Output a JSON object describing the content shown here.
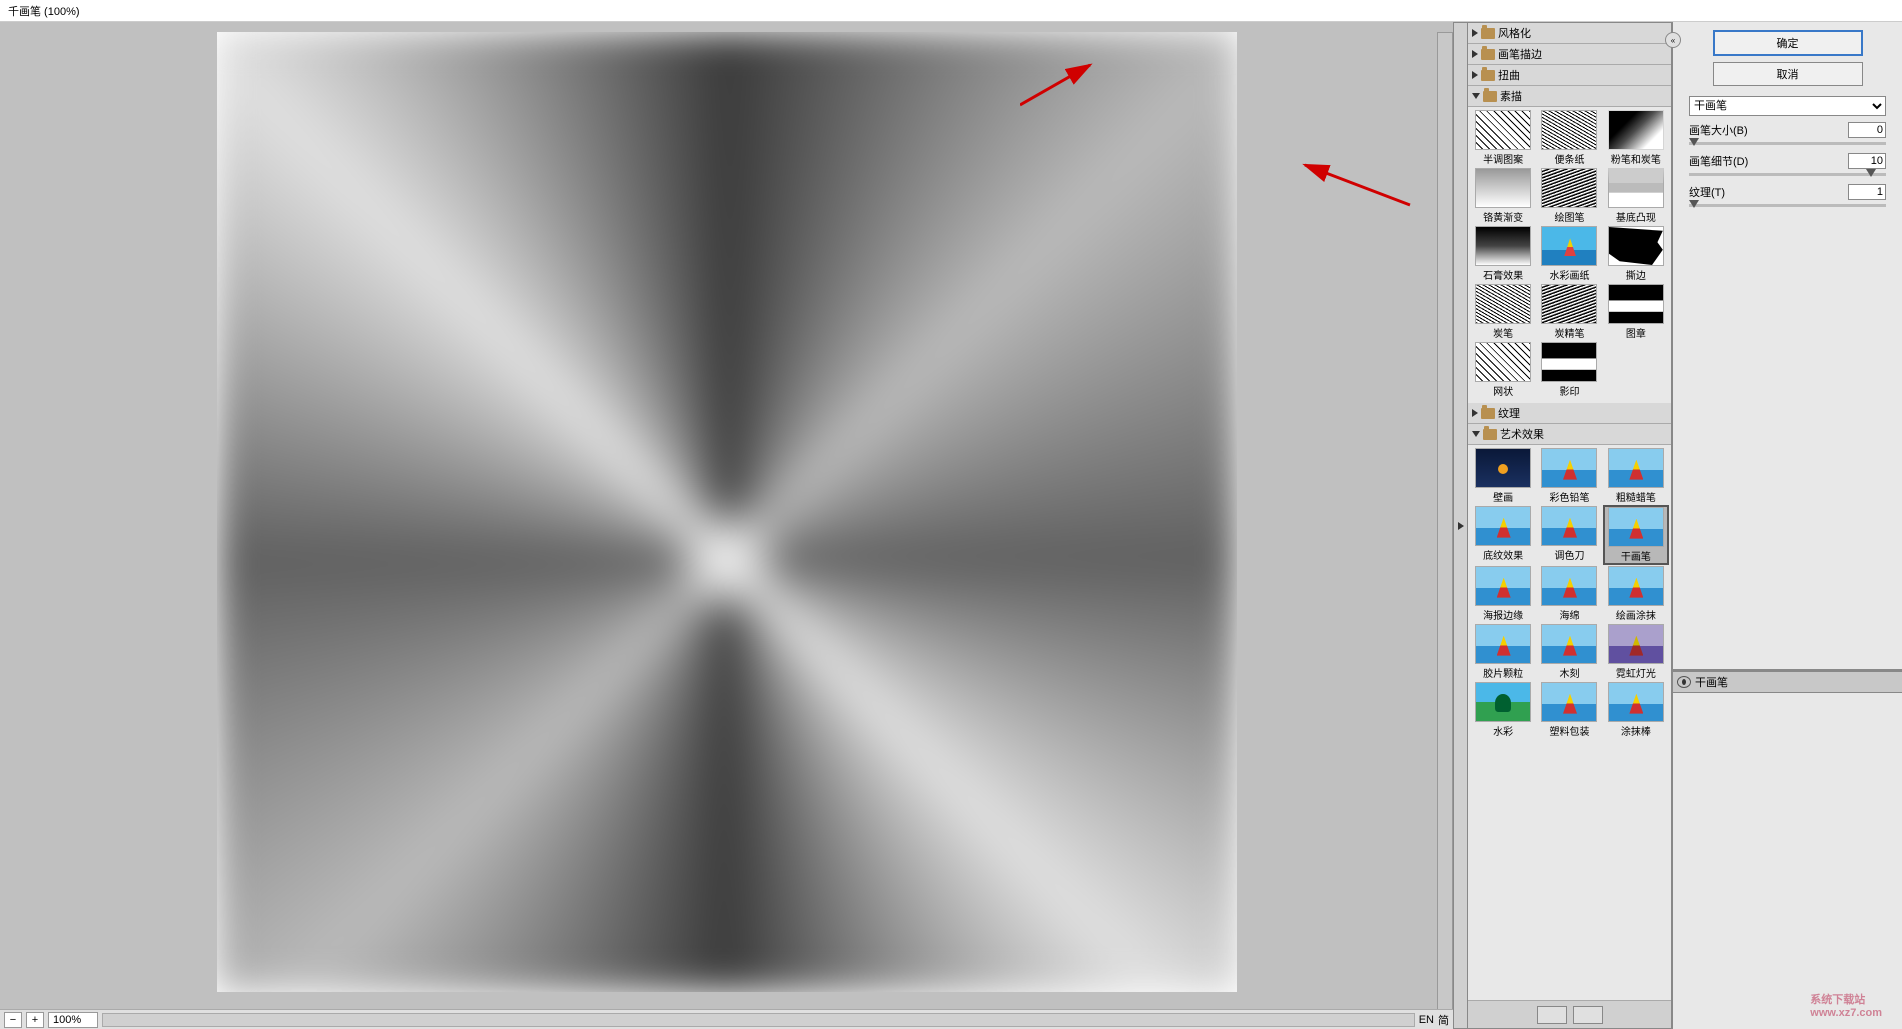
{
  "title": "千画笔 (100%)",
  "zoom": {
    "minus": "−",
    "plus": "+",
    "value": "100%"
  },
  "status": {
    "ime": "EN",
    "lang": "简"
  },
  "categories": {
    "stylize": "风格化",
    "brush_strokes": "画笔描边",
    "distort": "扭曲",
    "sketch": "素描",
    "texture": "纹理",
    "artistic": "艺术效果"
  },
  "sketch_thumbs": [
    {
      "label": "半调图案"
    },
    {
      "label": "便条纸"
    },
    {
      "label": "粉笔和炭笔"
    },
    {
      "label": "铬黄渐变"
    },
    {
      "label": "绘图笔"
    },
    {
      "label": "基底凸现"
    },
    {
      "label": "石膏效果"
    },
    {
      "label": "水彩画纸"
    },
    {
      "label": "撕边"
    },
    {
      "label": "炭笔"
    },
    {
      "label": "炭精笔"
    },
    {
      "label": "图章"
    },
    {
      "label": "网状"
    },
    {
      "label": "影印"
    }
  ],
  "artistic_thumbs": [
    {
      "label": "壁画"
    },
    {
      "label": "彩色铅笔"
    },
    {
      "label": "粗糙蜡笔"
    },
    {
      "label": "底纹效果"
    },
    {
      "label": "调色刀"
    },
    {
      "label": "干画笔"
    },
    {
      "label": "海报边缘"
    },
    {
      "label": "海绵"
    },
    {
      "label": "绘画涂抹"
    },
    {
      "label": "胶片颗粒"
    },
    {
      "label": "木刻"
    },
    {
      "label": "霓虹灯光"
    },
    {
      "label": "水彩"
    },
    {
      "label": "塑料包装"
    },
    {
      "label": "涂抹棒"
    }
  ],
  "buttons": {
    "ok": "确定",
    "cancel": "取消"
  },
  "filter_name": "干画笔",
  "params": {
    "brush_size": {
      "label": "画笔大小(B)",
      "value": "0"
    },
    "brush_detail": {
      "label": "画笔细节(D)",
      "value": "10"
    },
    "texture": {
      "label": "纹理(T)",
      "value": "1"
    }
  },
  "layer_name": "干画笔",
  "watermark_text": "系统下载站",
  "watermark_url": "www.xz7.com"
}
